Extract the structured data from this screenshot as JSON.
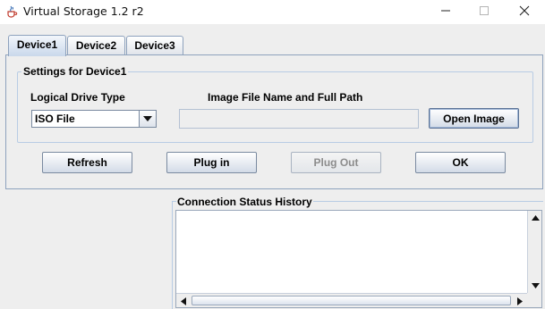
{
  "window": {
    "title": "Virtual Storage 1.2 r2"
  },
  "tabs": [
    {
      "label": "Device1",
      "active": true
    },
    {
      "label": "Device2",
      "active": false
    },
    {
      "label": "Device3",
      "active": false
    }
  ],
  "settings": {
    "group_title": "Settings for Device1",
    "drive_type_label": "Logical Drive Type",
    "drive_type_value": "ISO File",
    "path_label": "Image File Name and Full Path",
    "path_value": "",
    "open_image_label": "Open Image"
  },
  "actions": {
    "refresh_label": "Refresh",
    "plug_in_label": "Plug in",
    "plug_out_label": "Plug Out",
    "ok_label": "OK"
  },
  "status": {
    "title": "Connection Status History",
    "log": ""
  },
  "icons": {
    "app": "java-cup-icon",
    "minimize": "minimize-icon",
    "maximize": "maximize-icon",
    "close": "close-icon"
  },
  "colors": {
    "tab_border": "#8ea2bd",
    "group_border": "#b8cce4",
    "disabled_text": "#8c8c8c"
  }
}
